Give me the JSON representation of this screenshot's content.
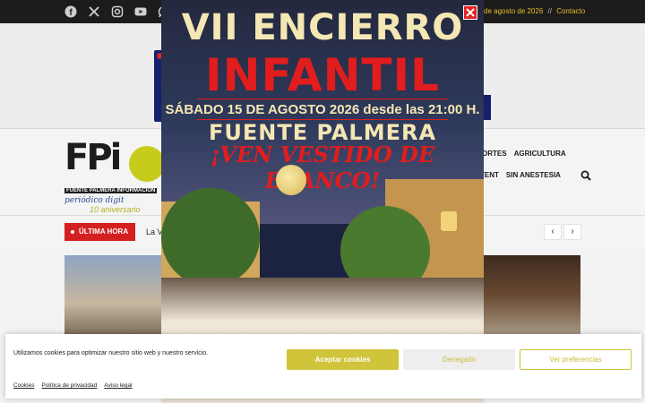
{
  "topbar": {
    "social_icons": [
      "facebook-icon",
      "x-icon",
      "instagram-icon",
      "youtube-icon",
      "whatsapp-icon"
    ],
    "date_text": "de agosto de 2026",
    "separator": "//",
    "contact_link": "Contacto"
  },
  "logo": {
    "text": "FPi",
    "tagline_bar": "FUENTE PALMERA INFORMACIÓN",
    "tagline": "periódico digit",
    "anniversary": "10 aniversario"
  },
  "nav": {
    "row1": [
      "ORTES",
      "AGRICULTURA"
    ],
    "row2": [
      "TENT",
      "SIN ANESTESIA"
    ]
  },
  "ticker": {
    "badge": "ÚLTIMA HORA",
    "headline": "La V",
    "prev": "‹",
    "next": "›"
  },
  "promo": {
    "title_line1": "VII ENCIERRO",
    "title_line2": "INFANTIL",
    "date_line": "SÁBADO 15 DE AGOSTO 2026 desde las 21:00 H.",
    "place": "FUENTE PALMERA",
    "slogan": "¡VEN VESTIDO DE BLANCO!",
    "close_label": "✕"
  },
  "cookie_banner": {
    "message": "Utilizamos cookies para optimizar nuestro sitio web y nuestro servicio.",
    "accept": "Aceptar cookies",
    "deny": "Denegado",
    "preferences": "Ver preferencias",
    "links": [
      "Cookies",
      "Política de privacidad",
      "Aviso legal"
    ]
  },
  "colors": {
    "accent_yellow": "#cfc43a",
    "brand_red": "#d42020",
    "topbar_bg": "#1c1c1c"
  }
}
